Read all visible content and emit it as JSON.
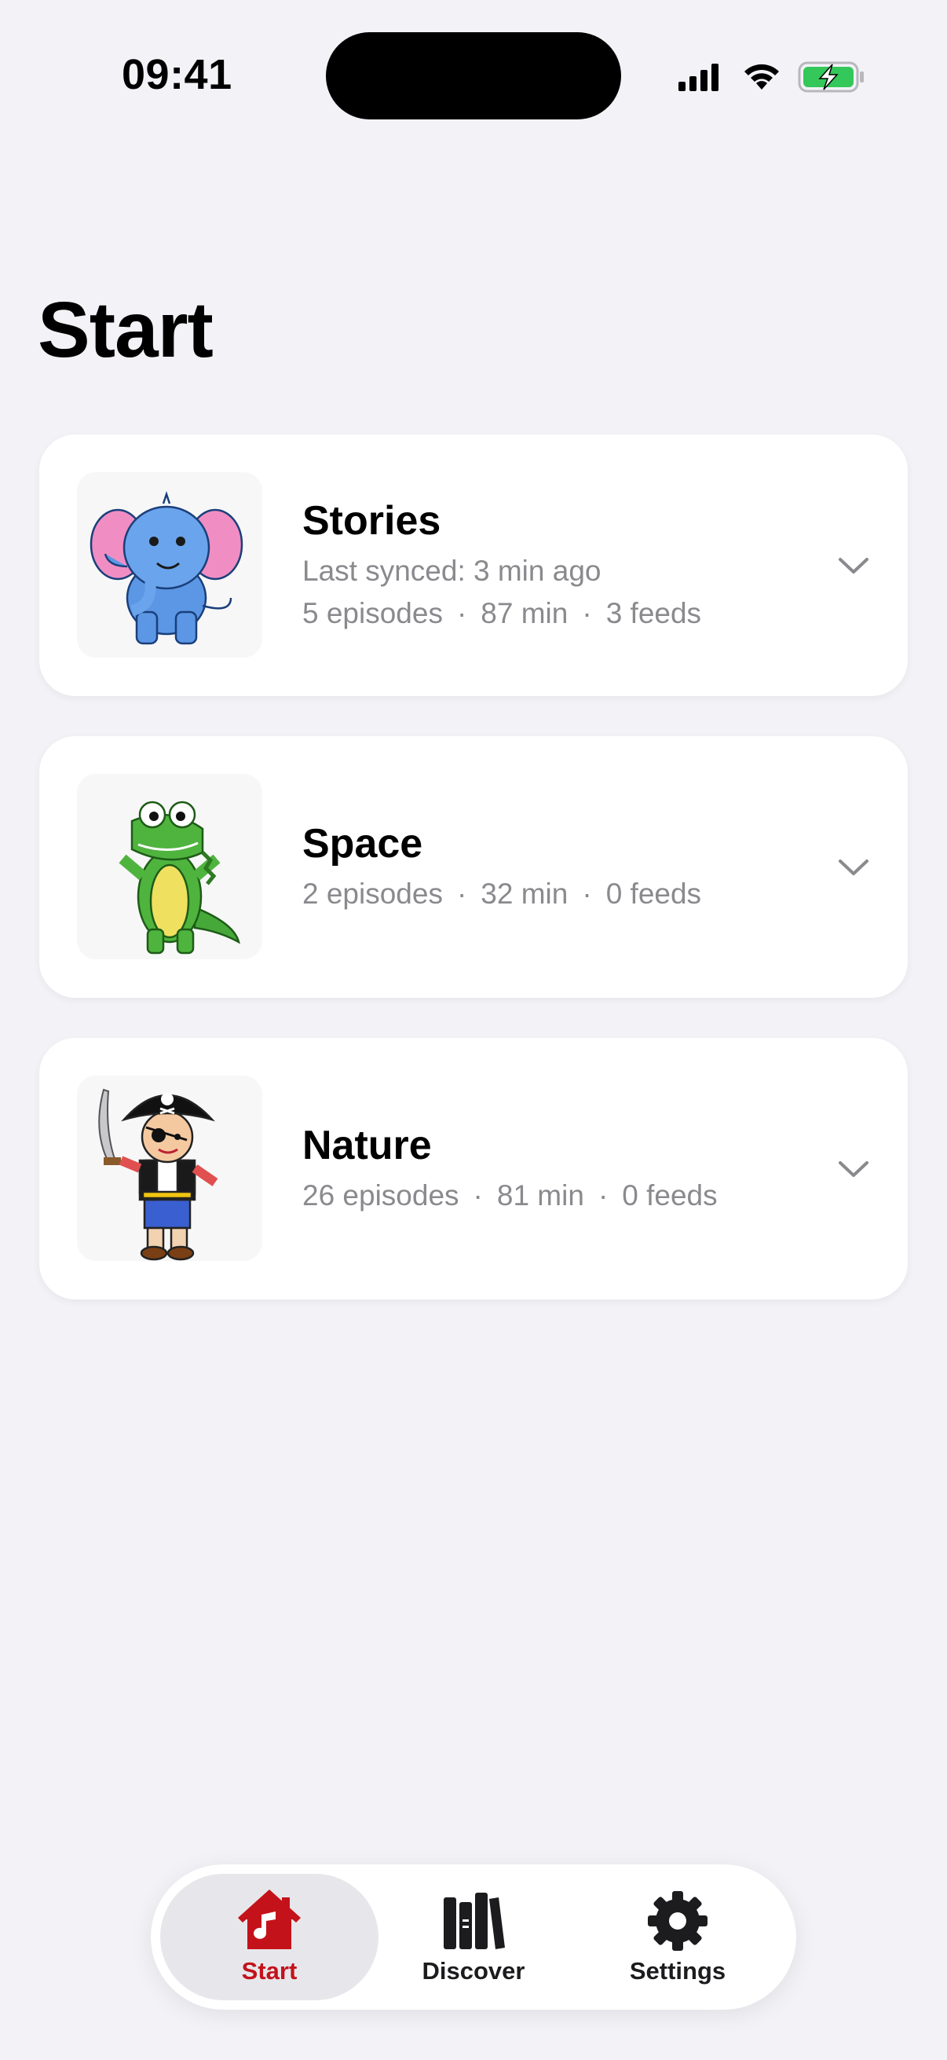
{
  "status_bar": {
    "time": "09:41"
  },
  "page": {
    "title": "Start"
  },
  "cards": [
    {
      "title": "Stories",
      "subtitle": "Last synced: 3 min ago",
      "episodes": "5 episodes",
      "duration": "87 min",
      "feeds": "3 feeds",
      "thumbnail": "elephant-drawing"
    },
    {
      "title": "Space",
      "episodes": "2 episodes",
      "duration": "32 min",
      "feeds": "0 feeds",
      "thumbnail": "crocodile-drawing"
    },
    {
      "title": "Nature",
      "episodes": "26 episodes",
      "duration": "81 min",
      "feeds": "0 feeds",
      "thumbnail": "pirate-drawing"
    }
  ],
  "meta_separator": "·",
  "tab_bar": {
    "tabs": [
      {
        "label": "Start",
        "icon": "home-music-icon",
        "active": true
      },
      {
        "label": "Discover",
        "icon": "books-icon",
        "active": false
      },
      {
        "label": "Settings",
        "icon": "gear-icon",
        "active": false
      }
    ]
  },
  "colors": {
    "background": "#f2f2f7",
    "accent": "#c4121a",
    "secondary_text": "#8a8a8e",
    "battery_green": "#34c759"
  }
}
